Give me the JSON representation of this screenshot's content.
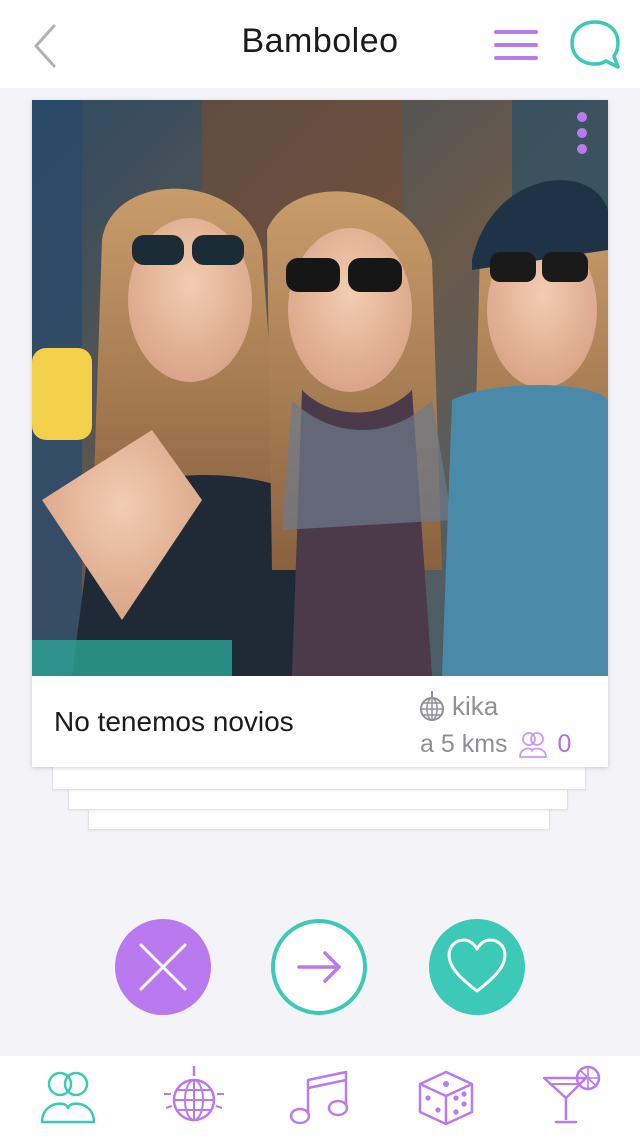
{
  "header": {
    "title": "Bamboleo",
    "back_icon": "chevron-left-icon",
    "menu_icon": "hamburger-menu-icon",
    "chat_icon": "chat-bubble-icon"
  },
  "colors": {
    "purple": "#b97aef",
    "teal": "#3cc9b8",
    "muted_text": "#8f8f95"
  },
  "card": {
    "image_alt": "group-selfie-photo",
    "title": "No tenemos novios",
    "author": "kika",
    "distance": "a 5 kms",
    "group_count": "0",
    "author_icon": "disco-ball-icon",
    "group_icon": "group-people-icon",
    "more_icon": "vertical-dots-icon"
  },
  "actions": {
    "reject_icon": "close-x-icon",
    "next_icon": "arrow-right-icon",
    "like_icon": "heart-icon"
  },
  "tabs": [
    {
      "icon": "group-people-icon",
      "active": true
    },
    {
      "icon": "disco-ball-icon",
      "active": false
    },
    {
      "icon": "music-note-icon",
      "active": false
    },
    {
      "icon": "dice-icon",
      "active": false
    },
    {
      "icon": "cocktail-icon",
      "active": false
    }
  ]
}
